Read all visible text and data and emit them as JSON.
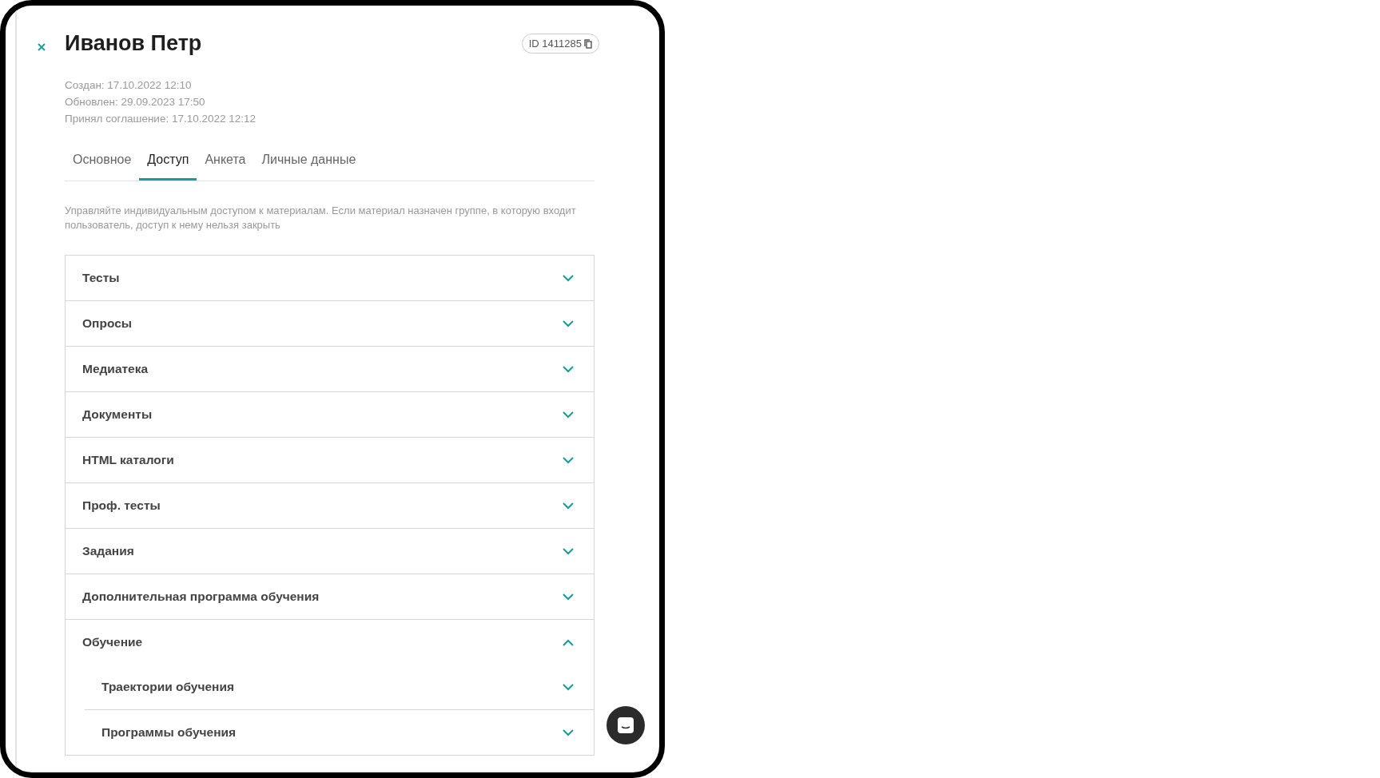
{
  "header": {
    "title": "Иванов Петр",
    "id_badge": "ID 1411285"
  },
  "meta": [
    "Создан: 17.10.2022 12:10",
    "Обновлен: 29.09.2023 17:50",
    "Принял соглашение: 17.10.2022 12:12"
  ],
  "tabs": [
    {
      "label": "Основное",
      "selected": false
    },
    {
      "label": "Доступ",
      "selected": true
    },
    {
      "label": "Анкета",
      "selected": false
    },
    {
      "label": "Личные данные",
      "selected": false
    }
  ],
  "description": "Управляйте индивидуальным доступом к материалам. Если материал назначен группе, в которую входит пользователь, доступ к нему нельзя закрыть",
  "sections": [
    {
      "label": "Тесты",
      "expanded": false
    },
    {
      "label": "Опросы",
      "expanded": false
    },
    {
      "label": "Медиатека",
      "expanded": false
    },
    {
      "label": "Документы",
      "expanded": false
    },
    {
      "label": "HTML каталоги",
      "expanded": false
    },
    {
      "label": "Проф. тесты",
      "expanded": false
    },
    {
      "label": "Задания",
      "expanded": false
    },
    {
      "label": "Дополнительная программа обучения",
      "expanded": false
    },
    {
      "label": "Обучение",
      "expanded": true,
      "children": [
        {
          "label": "Траектории обучения",
          "expanded": false
        },
        {
          "label": "Программы обучения",
          "expanded": false
        }
      ]
    }
  ]
}
